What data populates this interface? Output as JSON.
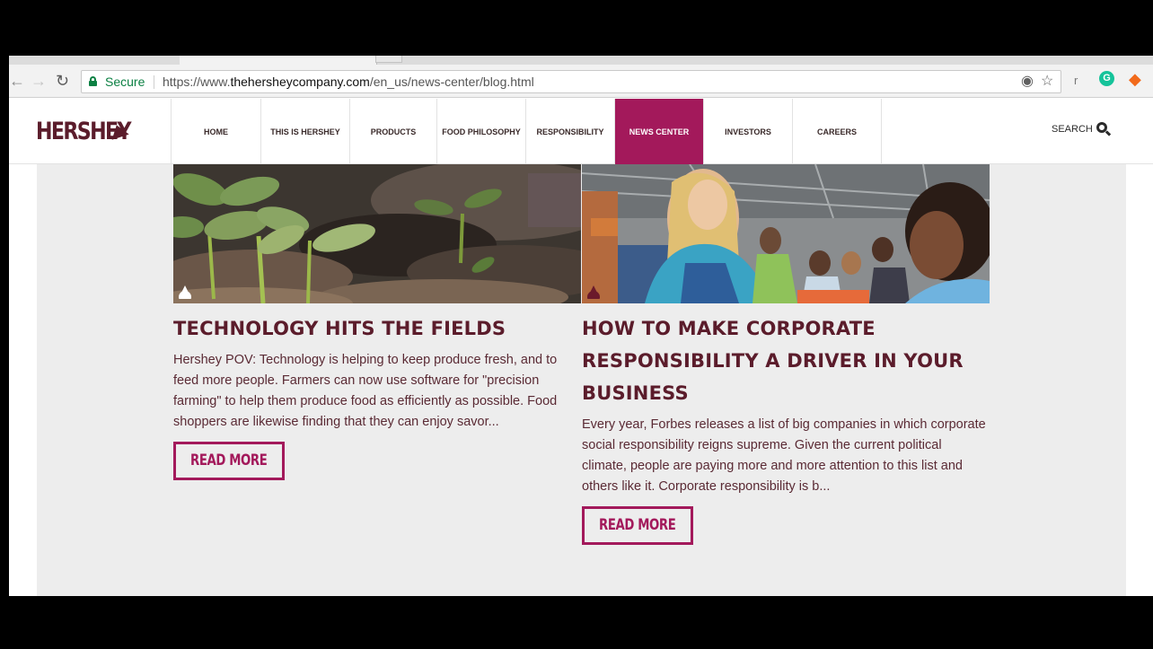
{
  "browser": {
    "secure_label": "Secure",
    "url_prefix": "https://www.",
    "url_domain": "thehersheycompany.com",
    "url_path": "/en_us/news-center/blog.html",
    "profile_initial": "r"
  },
  "site": {
    "logo_text": "HERSHEY",
    "nav": [
      {
        "label": "HOME"
      },
      {
        "label": "THIS IS HERSHEY"
      },
      {
        "label": "PRODUCTS"
      },
      {
        "label": "FOOD PHILOSOPHY"
      },
      {
        "label": "RESPONSIBILITY"
      },
      {
        "label": "NEWS CENTER",
        "active": true
      },
      {
        "label": "INVESTORS"
      },
      {
        "label": "CAREERS"
      }
    ],
    "search_label": "SEARCH",
    "accent_color": "#a3195b",
    "brand_color": "#5b1c2b"
  },
  "articles": [
    {
      "title": "TECHNOLOGY HITS THE FIELDS",
      "excerpt": "Hershey POV: Technology is helping to keep produce fresh, and to feed more people. Farmers can now use software for \"precision farming\" to help them produce food as efficiently as possible. Food shoppers are likewise finding that they can enjoy savor...",
      "read_more": "READ MORE",
      "image": "seedlings-photo",
      "badge_icon": "kiss-icon-white"
    },
    {
      "title": "HOW TO MAKE CORPORATE RESPONSIBILITY A DRIVER IN YOUR BUSINESS",
      "excerpt": "Every year, Forbes releases a list of big companies in which corporate social responsibility reigns supreme. Given the current political climate, people are paying more and more attention to this list and others like it. Corporate responsibility is b...",
      "read_more": "READ MORE",
      "image": "volunteers-photo",
      "badge_icon": "kiss-icon-maroon"
    }
  ]
}
